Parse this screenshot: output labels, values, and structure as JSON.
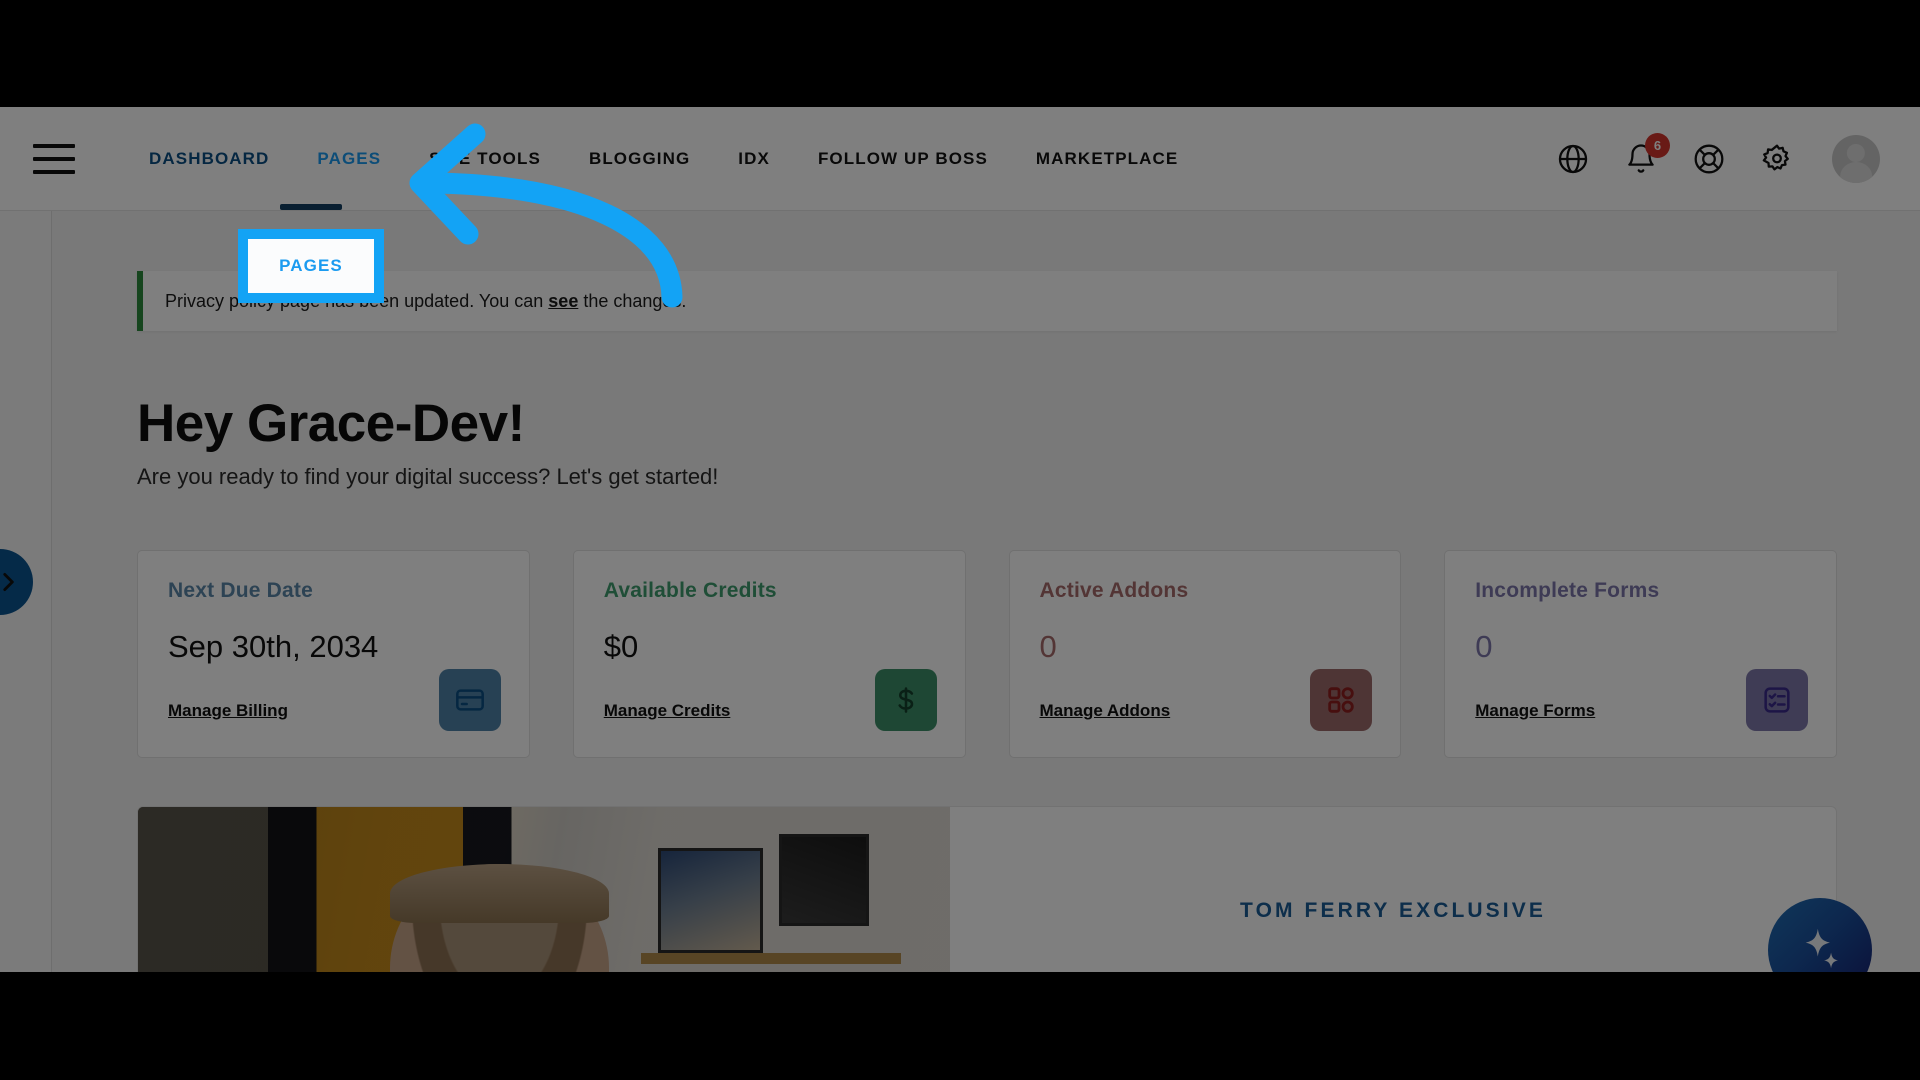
{
  "nav": {
    "menu_icon": "hamburger-icon",
    "links": [
      {
        "label": "DASHBOARD",
        "state": "active"
      },
      {
        "label": "PAGES",
        "state": "highlighted"
      },
      {
        "label": "SITE TOOLS",
        "state": "default"
      },
      {
        "label": "BLOGGING",
        "state": "default"
      },
      {
        "label": "IDX",
        "state": "default"
      },
      {
        "label": "FOLLOW UP BOSS",
        "state": "default"
      },
      {
        "label": "MARKETPLACE",
        "state": "default"
      }
    ],
    "icons": [
      {
        "name": "globe-icon"
      },
      {
        "name": "bell-icon",
        "badge": "6"
      },
      {
        "name": "life-ring-help-icon"
      },
      {
        "name": "gear-settings-icon"
      },
      {
        "name": "avatar"
      }
    ],
    "badge_color": "#d2352c",
    "active_color": "#0b4f84",
    "highlight_color": "#1b9bf0"
  },
  "left_rail": {
    "toggle_icon": "chevron-right-icon",
    "toggle_color": "#0a5490"
  },
  "notice": {
    "text_before": "Privacy policy page has been updated. You can ",
    "link": "see",
    "text_after": " the changes.",
    "accent_color": "#2d8b3c"
  },
  "greeting": {
    "heading": "Hey Grace-Dev!",
    "subheading": "Are you ready to find your digital success? Let's get started!"
  },
  "cards": [
    {
      "title": "Next Due Date",
      "value": "Sep 30th, 2034",
      "link": "Manage Billing",
      "icon": "credit-card-icon",
      "color": "#5a87a8",
      "icon_bg": "#4f83a8",
      "icon_color": "#0b4f84"
    },
    {
      "title": "Available Credits",
      "value": "$0",
      "link": "Manage Credits",
      "icon": "dollar-sign-icon",
      "color": "#3f9d6e",
      "icon_bg": "#3d8f68",
      "icon_color": "#14412c"
    },
    {
      "title": "Active Addons",
      "value": "0",
      "link": "Manage Addons",
      "icon": "grid-squares-icon",
      "color": "#a66b6b",
      "icon_bg": "#9d6b6b",
      "icon_color": "#8e1f1f"
    },
    {
      "title": "Incomplete Forms",
      "value": "0",
      "link": "Manage Forms",
      "icon": "checklist-icon",
      "color": "#7d77ab",
      "icon_bg": "#7e78ab",
      "icon_color": "#3b2a8c"
    }
  ],
  "promo": {
    "label": "TOM FERRY EXCLUSIVE",
    "label_color": "#1a5d96",
    "thumbnail": "video-thumbnail-person"
  },
  "ai_fab": {
    "icon": "sparkle-ai-icon"
  },
  "annotation": {
    "highlight_label": "PAGES",
    "highlight_color": "#13a3f5",
    "arrow": "curved-arrow-pointing-left"
  }
}
